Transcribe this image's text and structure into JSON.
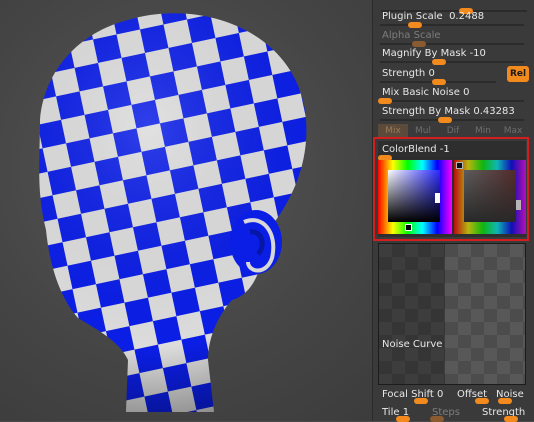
{
  "panel": {
    "plugin_scale": {
      "label": "Plugin Scale",
      "value": "0.2488",
      "level": 0.25
    },
    "alpha_scale": {
      "label": "Alpha Scale"
    },
    "magnify_by_mask": {
      "label": "Magnify By Mask",
      "value": "-10",
      "level": 0.45
    },
    "strength": {
      "label": "Strength",
      "value": "0",
      "level": 0.2
    },
    "rel_button": "Rel",
    "mix_basic_noise": {
      "label": "Mix Basic Noise",
      "value": "0",
      "level": 0.0
    },
    "strength_by_mask": {
      "label": "Strength By Mask",
      "value": "0.43283",
      "level": 0.43
    },
    "modes": [
      "Mix",
      "Mul",
      "Dif",
      "Min",
      "Max"
    ],
    "colorblend": {
      "label": "ColorBlend",
      "value": "-1",
      "level": 0.0
    },
    "noise_curve_label": "Noise Curve",
    "focal_shift": {
      "label": "Focal Shift",
      "value": "0"
    },
    "offset": {
      "label": "Offset"
    },
    "noise": {
      "label": "Noise"
    },
    "tile": {
      "label": "Tile",
      "value": "1"
    },
    "steps": {
      "label": "Steps"
    },
    "strength2": {
      "label": "Strength"
    }
  },
  "colors": {
    "accent": "#f28a1e",
    "highlight": "#d41e1e",
    "checker_blue": "#0b1ee6"
  }
}
